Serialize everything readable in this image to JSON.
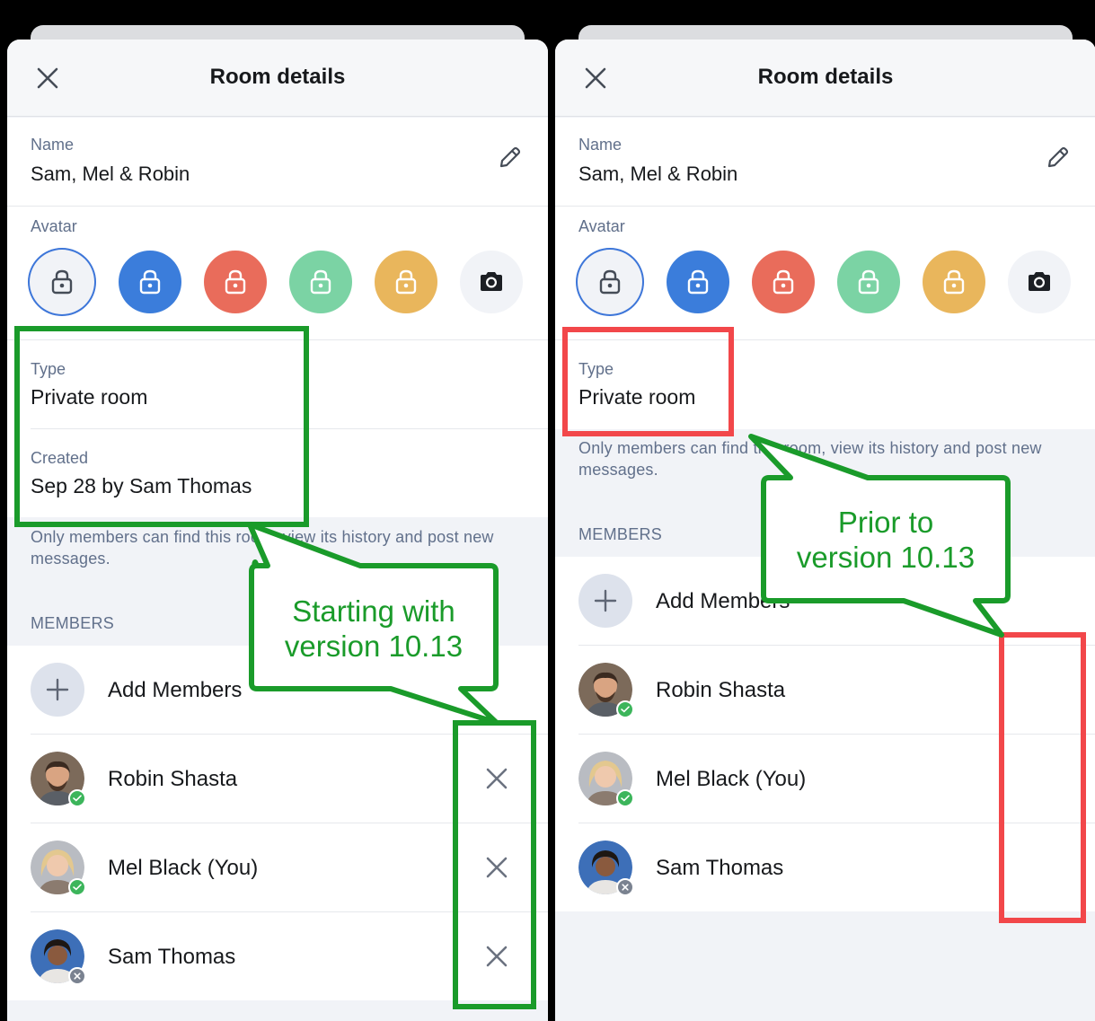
{
  "colors": {
    "annotation_green": "#1a9b2a",
    "annotation_red": "#f2474a",
    "avatar_colors": [
      "#f1f3f7",
      "#3b7ddb",
      "#e96c5b",
      "#7bd3a4",
      "#e9b65c",
      "#f1f3f7"
    ],
    "online_badge": "#3cb55b",
    "offline_badge": "#7a8290"
  },
  "left": {
    "header": {
      "title": "Room details",
      "close_icon": "close-icon"
    },
    "name": {
      "label": "Name",
      "value": "Sam, Mel & Robin",
      "edit_icon": "pencil-icon"
    },
    "avatar": {
      "label": "Avatar",
      "options": [
        "lock-icon",
        "lock-icon",
        "lock-icon",
        "lock-icon",
        "lock-icon",
        "camera-icon"
      ],
      "selected": 0
    },
    "type": {
      "label": "Type",
      "value": "Private room"
    },
    "created": {
      "label": "Created",
      "value": "Sep 28 by Sam Thomas"
    },
    "note": "Only members can find this room, view its history and post new messages.",
    "members_heading": "MEMBERS",
    "add_members": "Add Members",
    "members": [
      {
        "name": "Robin Shasta",
        "status": "online"
      },
      {
        "name": "Mel Black (You)",
        "status": "online"
      },
      {
        "name": "Sam Thomas",
        "status": "offline"
      }
    ],
    "annotation": {
      "line1": "Starting with",
      "line2": "version 10.13"
    }
  },
  "right": {
    "header": {
      "title": "Room details",
      "close_icon": "close-icon"
    },
    "name": {
      "label": "Name",
      "value": "Sam, Mel & Robin",
      "edit_icon": "pencil-icon"
    },
    "avatar": {
      "label": "Avatar",
      "options": [
        "lock-icon",
        "lock-icon",
        "lock-icon",
        "lock-icon",
        "lock-icon",
        "camera-icon"
      ],
      "selected": 0
    },
    "type": {
      "label": "Type",
      "value": "Private room"
    },
    "note": "Only members can find this room, view its history and post new messages.",
    "members_heading": "MEMBERS",
    "add_members": "Add Members",
    "members": [
      {
        "name": "Robin Shasta",
        "status": "online"
      },
      {
        "name": "Mel Black (You)",
        "status": "online"
      },
      {
        "name": "Sam Thomas",
        "status": "offline"
      }
    ],
    "annotation": {
      "line1": "Prior to",
      "line2": "version 10.13"
    }
  }
}
